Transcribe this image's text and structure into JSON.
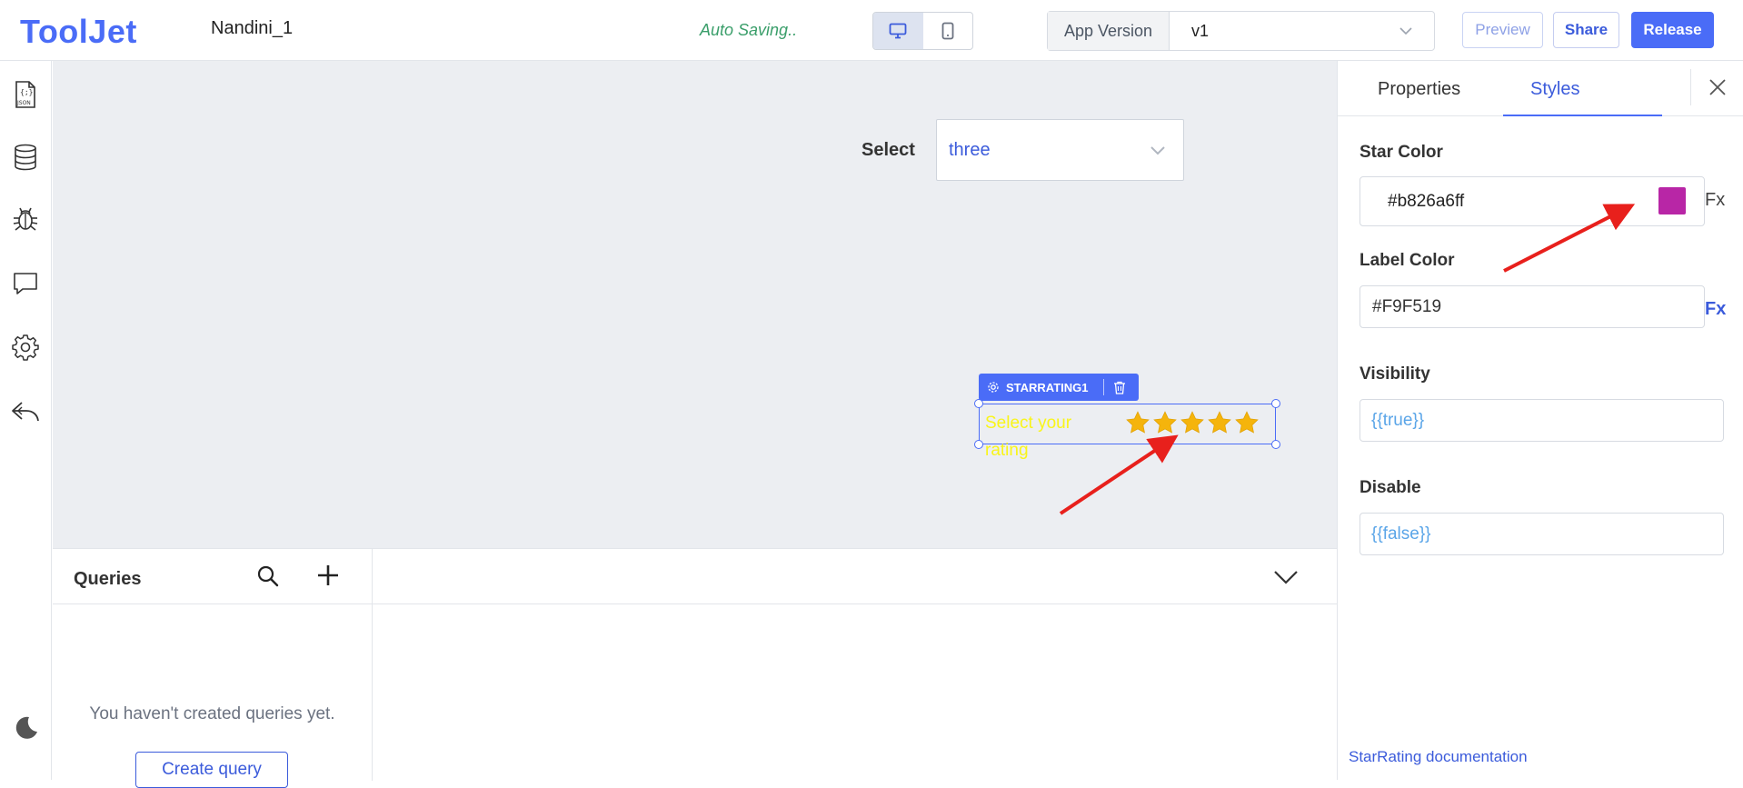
{
  "app": {
    "logo": "ToolJet",
    "name": "Nandini_1",
    "autosave_status": "Auto Saving.."
  },
  "header": {
    "device_modes": [
      "desktop",
      "mobile"
    ],
    "active_device": "desktop",
    "version_label": "App Version",
    "version_value": "v1",
    "preview_label": "Preview",
    "share_label": "Share",
    "release_label": "Release"
  },
  "sidebar": {
    "items": [
      {
        "name": "json-icon"
      },
      {
        "name": "database-icon"
      },
      {
        "name": "bug-icon"
      },
      {
        "name": "comment-icon"
      },
      {
        "name": "settings-icon"
      },
      {
        "name": "undo-icon"
      }
    ],
    "theme_toggle": "moon-icon"
  },
  "canvas": {
    "select": {
      "label": "Select",
      "value": "three"
    },
    "star_rating": {
      "tag": "STARRATING1",
      "label": "Select your rating",
      "star_count": 5,
      "star_color": "#f5b40c",
      "label_color": "#F9F519"
    }
  },
  "queries": {
    "title": "Queries",
    "empty_text": "You haven't created queries yet.",
    "create_label": "Create query"
  },
  "inspector": {
    "tabs": [
      {
        "label": "Properties",
        "active": false
      },
      {
        "label": "Styles",
        "active": true
      }
    ],
    "star_color": {
      "label": "Star Color",
      "value": "#b826a6ff",
      "swatch": "#b826a6",
      "fx": "Fx"
    },
    "label_color": {
      "label": "Label Color",
      "value": "#F9F519",
      "fx": "Fx"
    },
    "visibility": {
      "label": "Visibility",
      "value": "{{true}}"
    },
    "disable": {
      "label": "Disable",
      "value": "{{false}}"
    },
    "doc_link": "StarRating documentation"
  },
  "colors": {
    "brand": "#4a6cf7",
    "canvas_bg": "#eceef2",
    "annotation_arrow": "#e8201c"
  }
}
